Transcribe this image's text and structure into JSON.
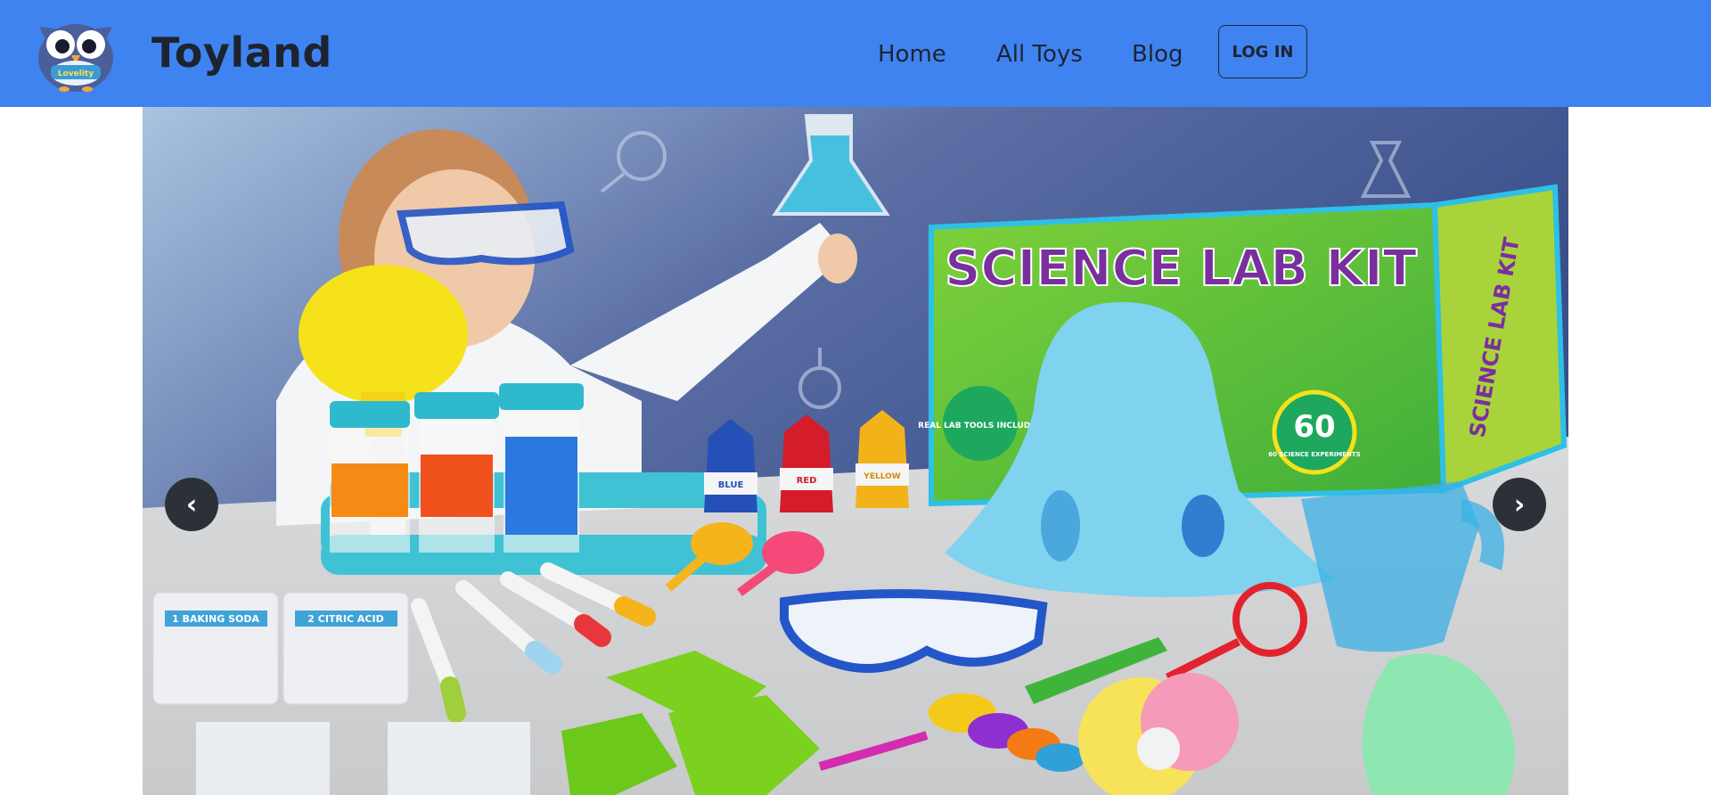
{
  "header": {
    "brand": "Toyland",
    "logo_icon": "owl-logo-icon",
    "logo_text": "Lovelity",
    "nav": [
      {
        "label": "Home"
      },
      {
        "label": "All Toys"
      },
      {
        "label": "Blog"
      }
    ],
    "login_label": "LOG IN"
  },
  "carousel": {
    "prev_label": "‹",
    "next_label": "›",
    "slide": {
      "box_title": "SCIENCE LAB KIT",
      "box_side_title": "SCIENCE LAB KIT",
      "box_badge": "60 SCIENCE EXPERIMENTS",
      "box_badge_number": "60",
      "box_tools_badge": "REAL LAB TOOLS INCLUDED",
      "bottles": [
        "BLUE",
        "RED",
        "YELLOW"
      ],
      "packets": [
        {
          "number": "1",
          "name": "BAKING SODA"
        },
        {
          "number": "2",
          "name": "CITRIC ACID"
        }
      ]
    }
  },
  "colors": {
    "navbar": "#3f83f1",
    "text": "#1d2430",
    "carousel_button": "#2c3138"
  }
}
